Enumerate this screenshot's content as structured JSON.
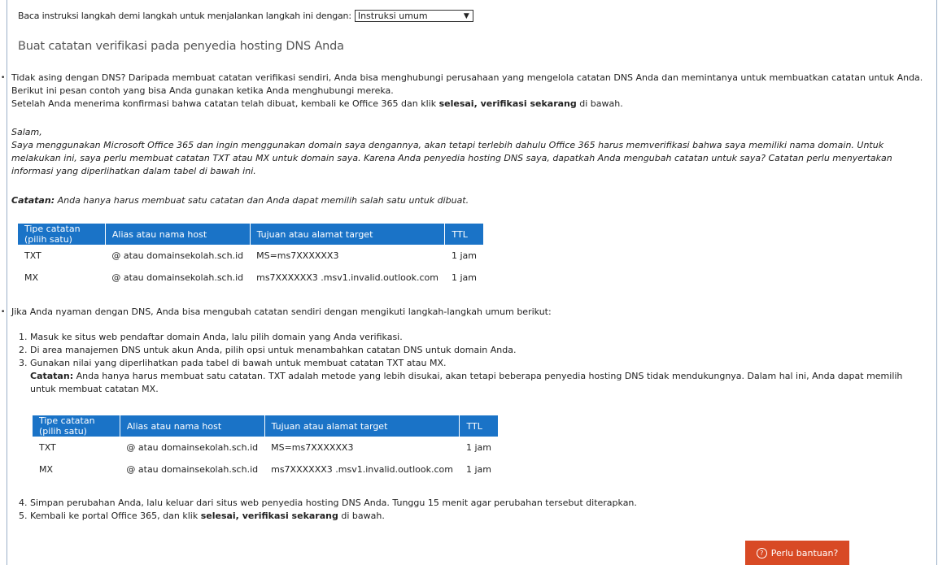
{
  "instruction_label": "Baca instruksi langkah demi langkah untuk menjalankan langkah ini dengan:",
  "instruction_select": "Instruksi umum",
  "heading": "Buat catatan verifikasi pada penyedia hosting DNS Anda",
  "bullet1": {
    "p1": "Tidak asing dengan DNS? Daripada membuat catatan verifikasi sendiri, Anda bisa menghubungi perusahaan yang mengelola catatan DNS Anda dan memintanya untuk membuatkan catatan untuk Anda. Berikut ini pesan contoh yang bisa Anda gunakan ketika Anda menghubungi mereka.",
    "p2_pre": "Setelah Anda menerima konfirmasi bahwa catatan telah dibuat, kembali ke Office 365 dan klik ",
    "p2_bold": "selesai, verifikasi sekarang",
    "p2_post": " di bawah.",
    "greeting": "Salam,",
    "message": "Saya menggunakan Microsoft Office 365 dan ingin menggunakan domain saya dengannya, akan tetapi terlebih dahulu Office 365 harus memverifikasi bahwa saya memiliki nama domain. Untuk melakukan ini, saya perlu membuat catatan TXT atau MX untuk domain saya. Karena Anda penyedia hosting DNS saya, dapatkah Anda mengubah catatan untuk saya? Catatan perlu menyertakan informasi yang diperlihatkan dalam tabel di bawah ini.",
    "note_bold": "Catatan:",
    "note_text": " Anda hanya harus membuat satu catatan dan Anda dapat memilih salah satu untuk dibuat."
  },
  "table": {
    "headers": [
      "Tipe catatan (pilih satu)",
      "Alias atau nama host",
      "Tujuan atau alamat target",
      "TTL"
    ],
    "rows": [
      [
        "TXT",
        "@ atau domainsekolah.sch.id",
        "MS=ms7XXXXXX3",
        "1 jam"
      ],
      [
        "MX",
        "@ atau domainsekolah.sch.id",
        "ms7XXXXXX3 .msv1.invalid.outlook.com",
        "1 jam"
      ]
    ]
  },
  "bullet2": {
    "intro": "Jika Anda nyaman dengan DNS, Anda bisa mengubah catatan sendiri dengan mengikuti langkah-langkah umum berikut:",
    "steps": [
      "Masuk ke situs web pendaftar domain Anda, lalu pilih domain yang Anda verifikasi.",
      "Di area manajemen DNS untuk akun Anda, pilih opsi untuk menambahkan catatan DNS untuk domain Anda.",
      "Gunakan nilai yang diperlihatkan pada tabel di bawah untuk membuat catatan TXT atau MX."
    ],
    "step3_note_bold": "Catatan:",
    "step3_note_text": " Anda hanya harus membuat satu catatan. TXT adalah metode yang lebih disukai, akan tetapi beberapa penyedia hosting DNS tidak mendukungnya. Dalam hal ini, Anda dapat memilih untuk membuat catatan MX.",
    "step4": "Simpan perubahan Anda, lalu keluar dari situs web penyedia hosting DNS Anda. Tunggu 15 menit agar perubahan tersebut diterapkan.",
    "step5_pre": "Kembali ke portal Office 365, dan klik ",
    "step5_bold": "selesai, verifikasi sekarang",
    "step5_post": " di bawah."
  },
  "help_button": "Perlu bantuan?",
  "colors": {
    "table_header": "#1a73c7",
    "help_button": "#d84a25"
  }
}
